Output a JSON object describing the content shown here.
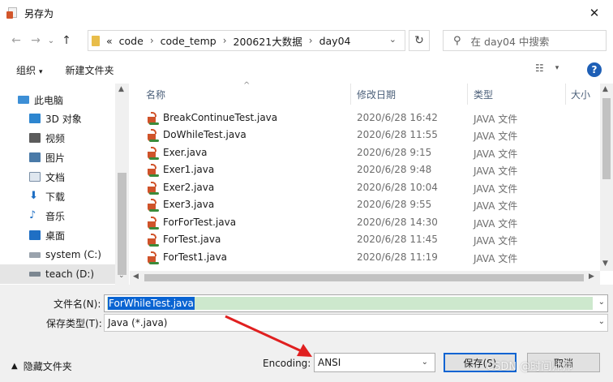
{
  "window": {
    "title": "另存为",
    "close_glyph": "✕"
  },
  "address": {
    "prefix": "«",
    "crumbs": [
      "code",
      "code_temp",
      "200621大数据",
      "day04"
    ],
    "search_placeholder": "在 day04 中搜索"
  },
  "toolbar": {
    "organize_label": "组织",
    "new_folder_label": "新建文件夹"
  },
  "nav": {
    "items": [
      {
        "label": "此电脑",
        "icon": "computer-icon"
      },
      {
        "label": "3D 对象",
        "icon": "3d-objects-icon"
      },
      {
        "label": "视频",
        "icon": "video-icon"
      },
      {
        "label": "图片",
        "icon": "pictures-icon"
      },
      {
        "label": "文档",
        "icon": "documents-icon"
      },
      {
        "label": "下载",
        "icon": "download-icon"
      },
      {
        "label": "音乐",
        "icon": "music-icon"
      },
      {
        "label": "桌面",
        "icon": "desktop-icon"
      },
      {
        "label": "system (C:)",
        "icon": "drive-icon"
      },
      {
        "label": "teach (D:)",
        "icon": "drive-icon"
      }
    ],
    "selected_index": 9
  },
  "columns": {
    "name": "名称",
    "date": "修改日期",
    "type": "类型",
    "size": "大小"
  },
  "files": [
    {
      "name": "BreakContinueTest.java",
      "date": "2020/6/28 16:42",
      "type": "JAVA 文件"
    },
    {
      "name": "DoWhileTest.java",
      "date": "2020/6/28 11:55",
      "type": "JAVA 文件"
    },
    {
      "name": "Exer.java",
      "date": "2020/6/28 9:15",
      "type": "JAVA 文件"
    },
    {
      "name": "Exer1.java",
      "date": "2020/6/28 9:48",
      "type": "JAVA 文件"
    },
    {
      "name": "Exer2.java",
      "date": "2020/6/28 10:04",
      "type": "JAVA 文件"
    },
    {
      "name": "Exer3.java",
      "date": "2020/6/28 9:55",
      "type": "JAVA 文件"
    },
    {
      "name": "ForForTest.java",
      "date": "2020/6/28 14:30",
      "type": "JAVA 文件"
    },
    {
      "name": "ForTest.java",
      "date": "2020/6/28 11:45",
      "type": "JAVA 文件"
    },
    {
      "name": "ForTest1.java",
      "date": "2020/6/28 11:19",
      "type": "JAVA 文件"
    }
  ],
  "form": {
    "filename_label": "文件名(N):",
    "filename_value": "ForWhileTest.java",
    "filetype_label": "保存类型(T):",
    "filetype_value": "Java (*.java)"
  },
  "footer": {
    "hide_folders_label": "隐藏文件夹",
    "encoding_label": "Encoding:",
    "encoding_value": "ANSI",
    "save_label": "保存(S)",
    "cancel_label": "取消",
    "watermark": "CSDN @时间师师"
  },
  "colors": {
    "selection_blue": "#0a64d2",
    "arrow_red": "#e02020"
  }
}
